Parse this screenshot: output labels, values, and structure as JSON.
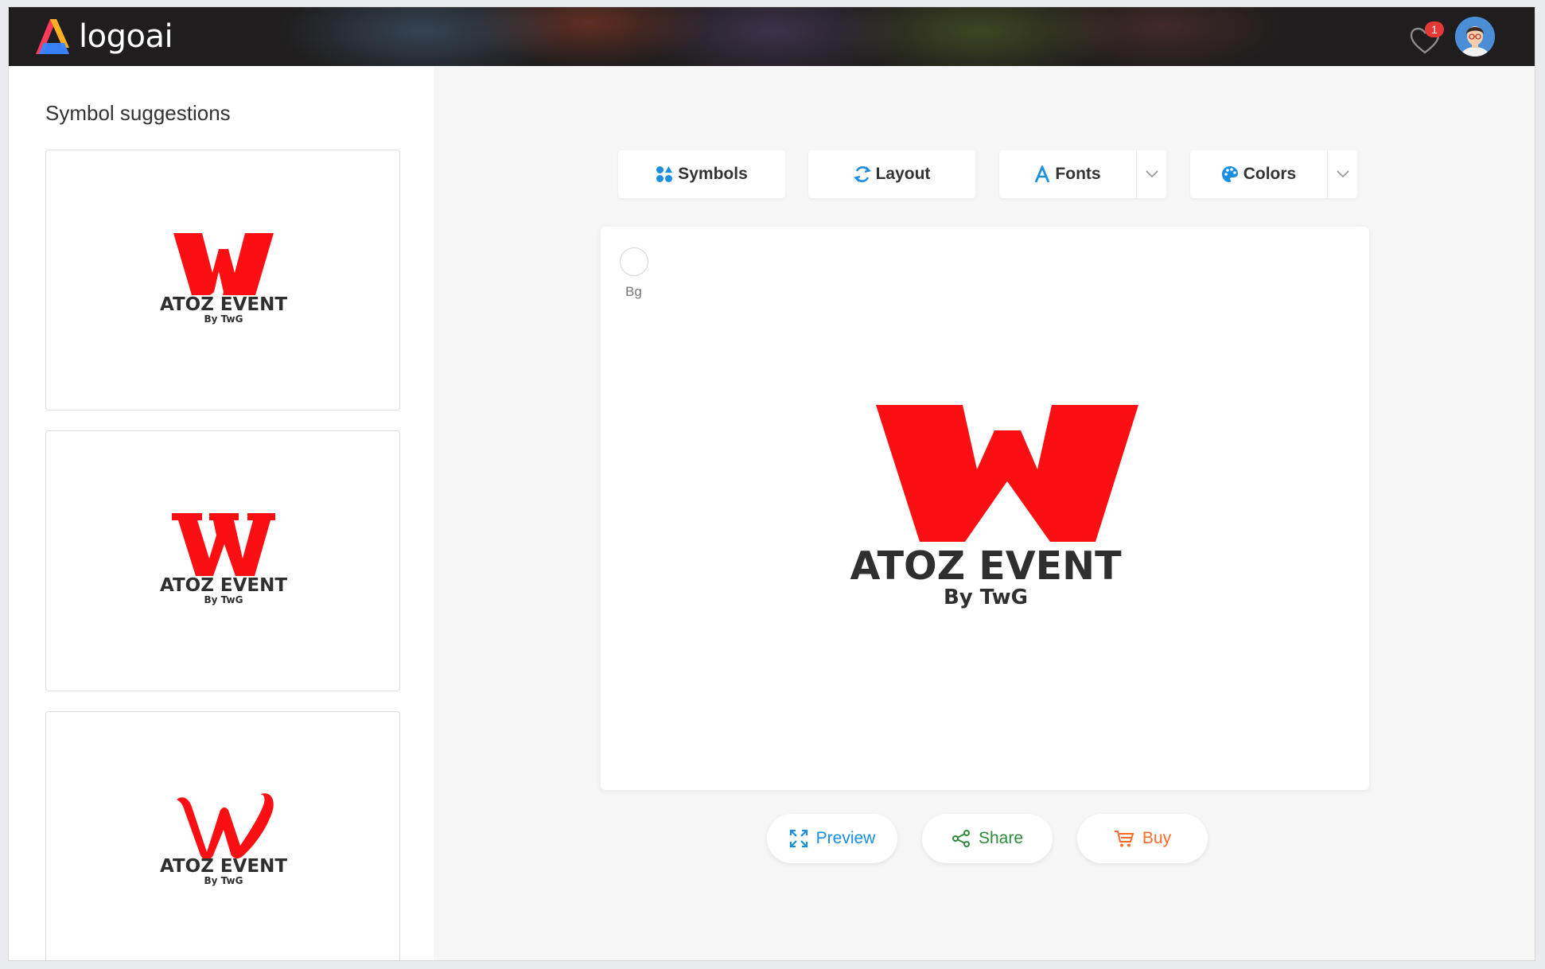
{
  "app": {
    "brand_name": "logoai",
    "favorites_count": "1",
    "colors": {
      "topbar_bg": "#1f1d1d",
      "accent_red": "#fb0f12",
      "text_dark": "#333333",
      "preview_blue": "#1a8ee0",
      "share_green": "#2e8b3a",
      "buy_orange": "#ff6a2b"
    }
  },
  "sidebar": {
    "title": "Symbol suggestions",
    "suggestions": [
      {
        "symbol": "W",
        "style": "heavy-sans",
        "name": "ATOZ EVENT",
        "tagline": "By TwG"
      },
      {
        "symbol": "W",
        "style": "slab-serif",
        "name": "ATOZ EVENT",
        "tagline": "By TwG"
      },
      {
        "symbol": "W",
        "style": "script",
        "name": "ATOZ EVENT",
        "tagline": "By TwG"
      }
    ]
  },
  "toolbar": {
    "symbols_label": "Symbols",
    "layout_label": "Layout",
    "fonts_label": "Fonts",
    "colors_label": "Colors"
  },
  "canvas": {
    "bg_label": "Bg",
    "logo": {
      "symbol": "W",
      "name": "ATOZ EVENT",
      "tagline": "By TwG"
    }
  },
  "actions": {
    "preview_label": "Preview",
    "share_label": "Share",
    "buy_label": "Buy"
  }
}
